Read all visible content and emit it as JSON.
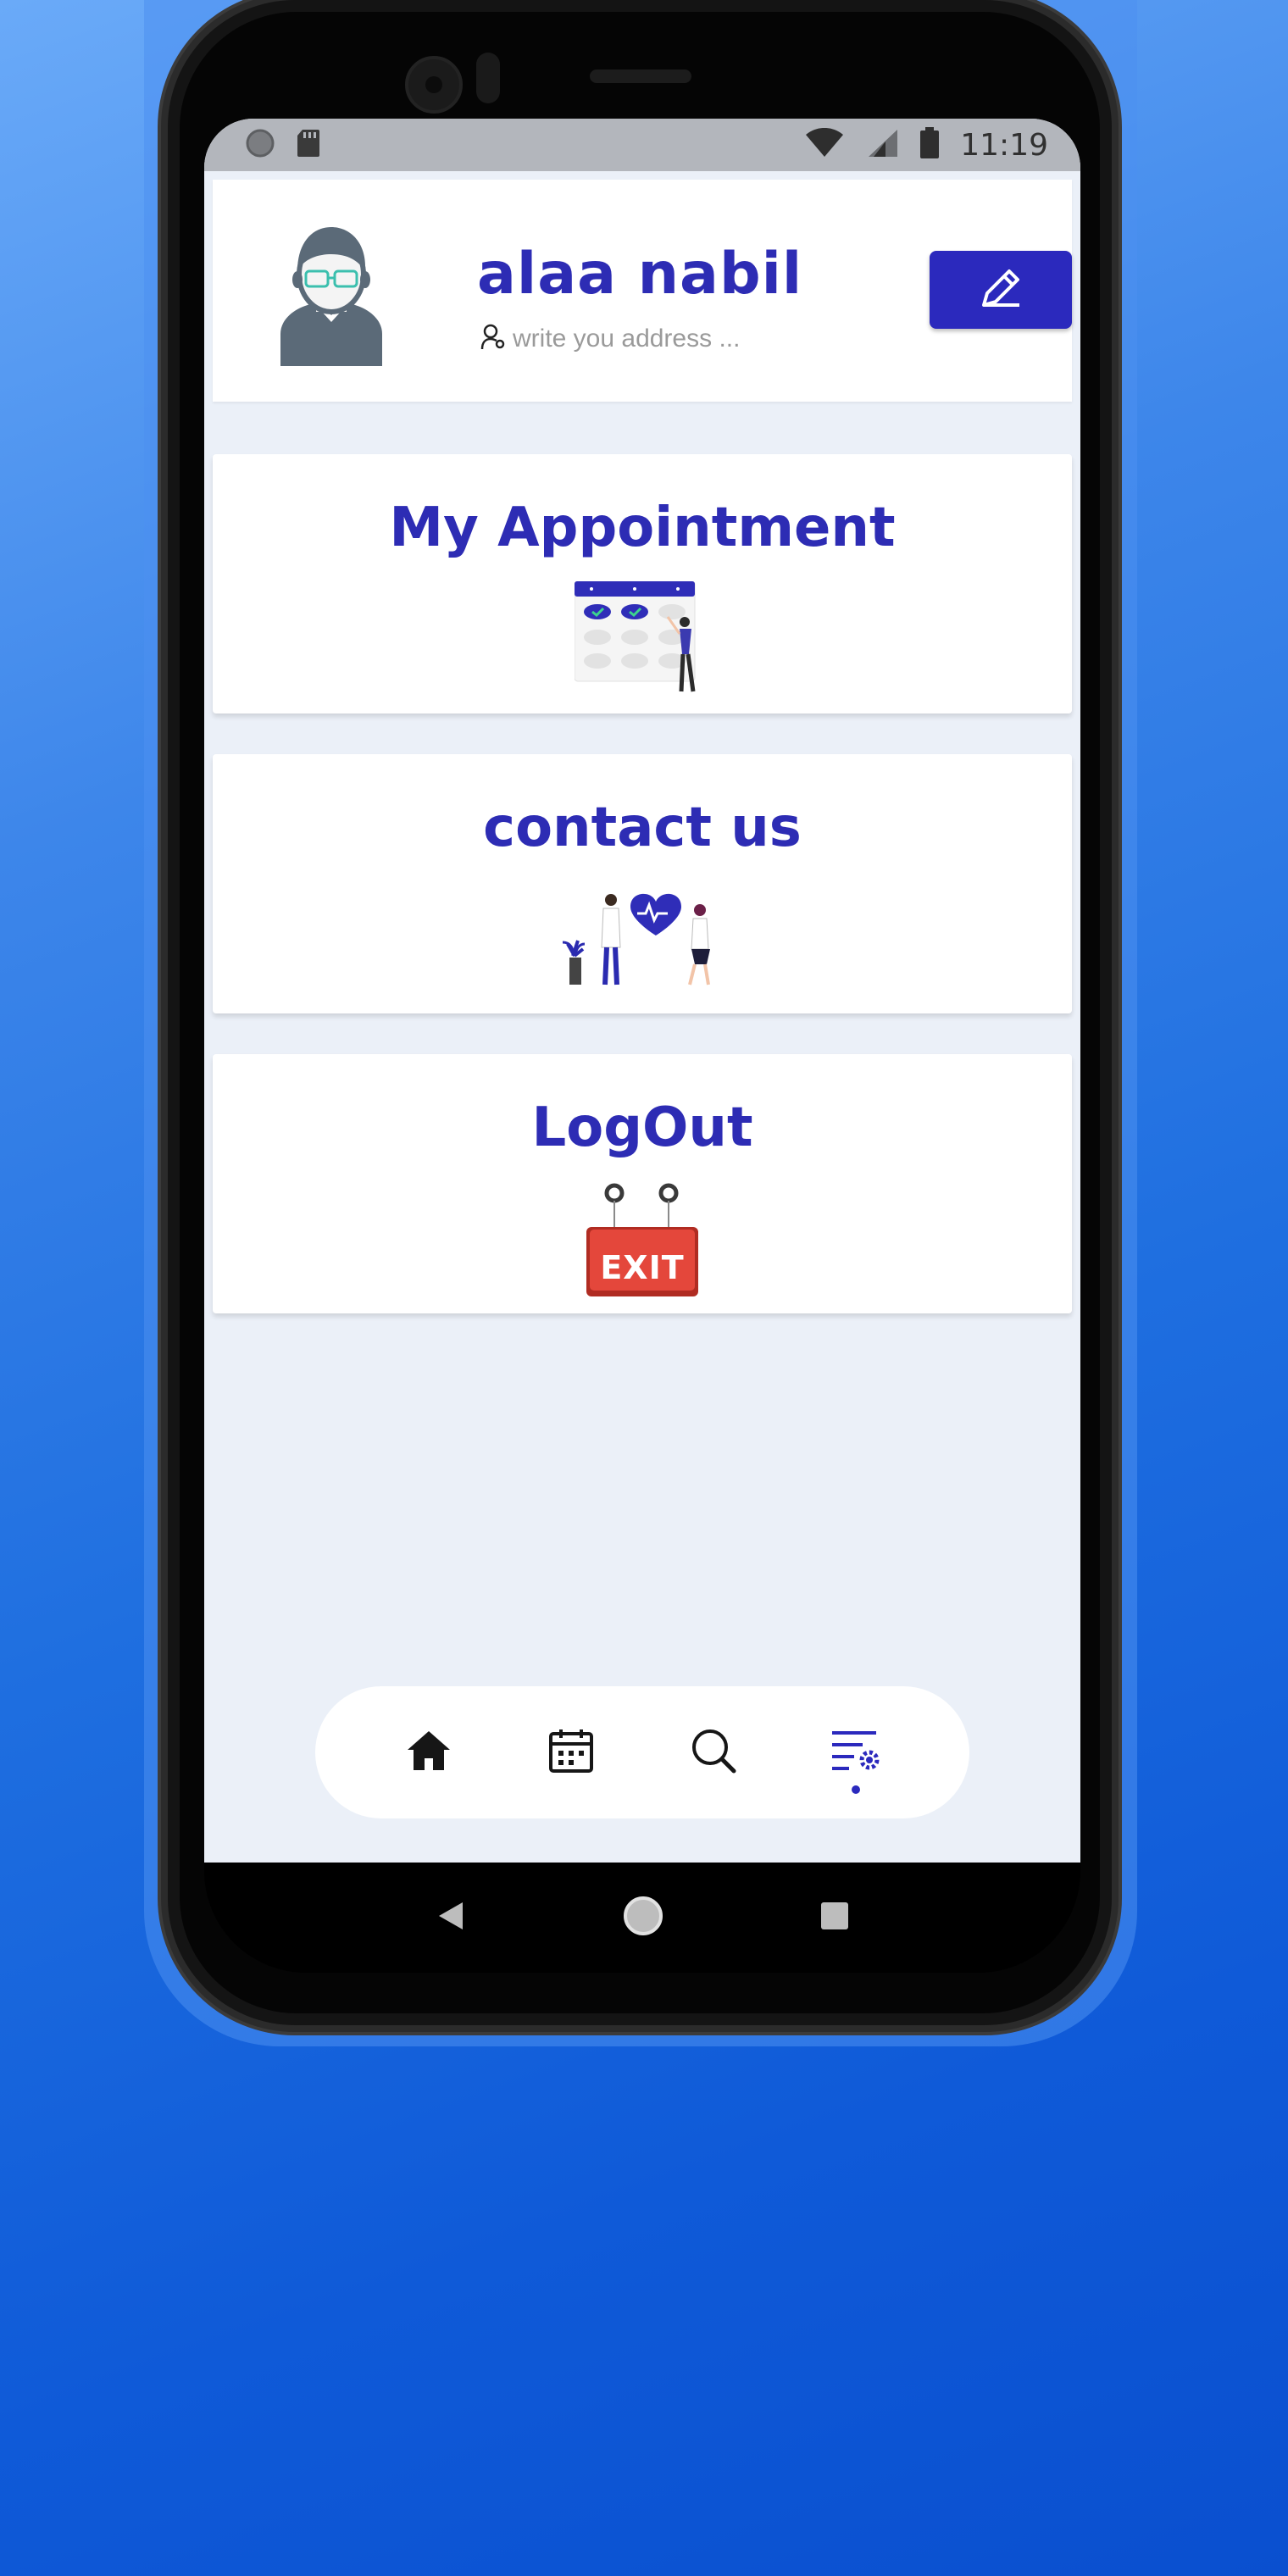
{
  "status_bar": {
    "time": "11:19",
    "icons": [
      "record-icon",
      "sd-card-icon",
      "wifi-icon",
      "signal-icon",
      "battery-icon"
    ]
  },
  "profile": {
    "name": "alaa nabil",
    "address_placeholder": "write you address ...",
    "edit_icon": "pencil-icon"
  },
  "menu": [
    {
      "label": "My Appointment",
      "illustration": "calendar-appointment-illustration"
    },
    {
      "label": "contact us",
      "illustration": "doctors-heart-illustration"
    },
    {
      "label": "LogOut",
      "illustration": "exit-sign-illustration",
      "sign_text": "EXIT"
    }
  ],
  "bottom_nav": {
    "items": [
      "home-icon",
      "calendar-icon",
      "search-icon",
      "settings-list-icon"
    ],
    "active": "settings-list-icon"
  },
  "colors": {
    "accent": "#2d2cb4",
    "button": "#2b29bd",
    "screen_bg": "#ebf0f8",
    "exit_red": "#e4473b"
  }
}
